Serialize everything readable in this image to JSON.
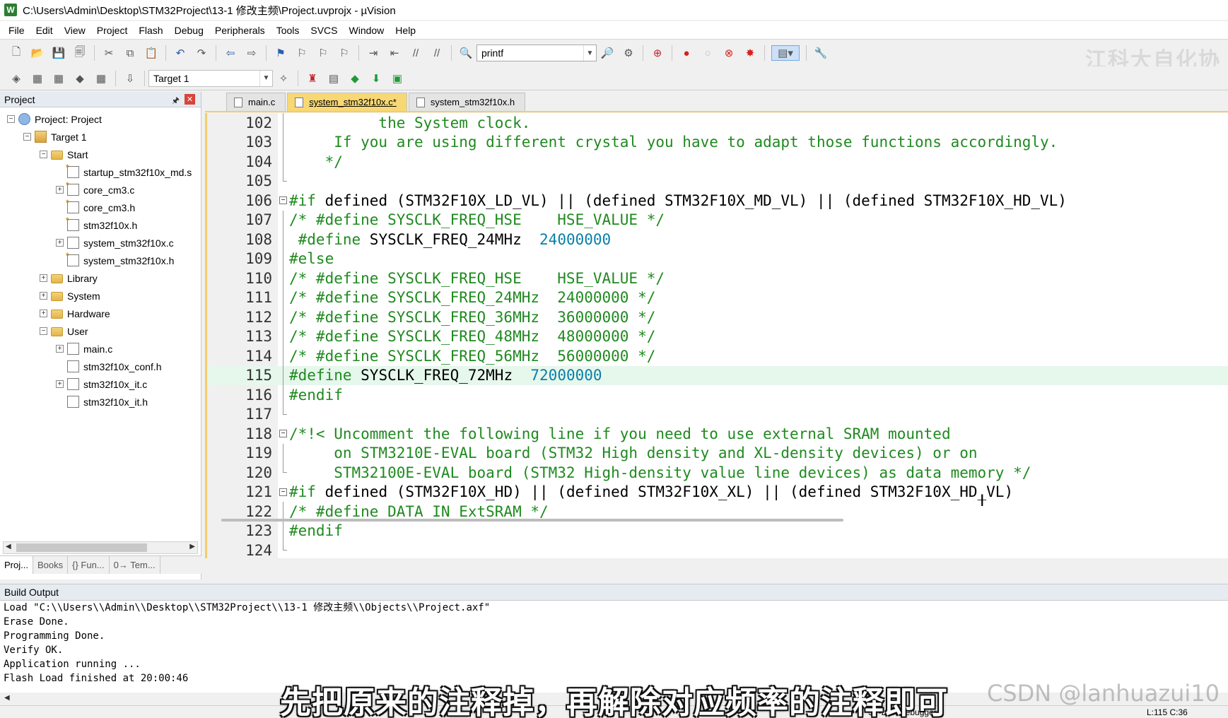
{
  "window": {
    "title": "C:\\Users\\Admin\\Desktop\\STM32Project\\13-1 修改主频\\Project.uvprojx - µVision",
    "app_icon": "W"
  },
  "menu": [
    "File",
    "Edit",
    "View",
    "Project",
    "Flash",
    "Debug",
    "Peripherals",
    "Tools",
    "SVCS",
    "Window",
    "Help"
  ],
  "toolbar1": {
    "find_value": "printf"
  },
  "toolbar2": {
    "target_value": "Target 1"
  },
  "watermark_logo": "江科大自化协",
  "project_panel": {
    "title": "Project",
    "tree": [
      {
        "label": "Project: Project",
        "expander": "−",
        "icon": "project"
      },
      {
        "label": "Target 1",
        "expander": "−",
        "icon": "target"
      },
      {
        "label": "Start",
        "expander": "−",
        "icon": "folder"
      },
      {
        "label": "startup_stm32f10x_md.s",
        "expander": "",
        "icon": "file-ast"
      },
      {
        "label": "core_cm3.c",
        "expander": "+",
        "icon": "file-ast"
      },
      {
        "label": "core_cm3.h",
        "expander": "",
        "icon": "file-ast"
      },
      {
        "label": "stm32f10x.h",
        "expander": "",
        "icon": "file-ast"
      },
      {
        "label": "system_stm32f10x.c",
        "expander": "+",
        "icon": "file"
      },
      {
        "label": "system_stm32f10x.h",
        "expander": "",
        "icon": "file-ast"
      },
      {
        "label": "Library",
        "expander": "+",
        "icon": "folder"
      },
      {
        "label": "System",
        "expander": "+",
        "icon": "folder"
      },
      {
        "label": "Hardware",
        "expander": "+",
        "icon": "folder"
      },
      {
        "label": "User",
        "expander": "−",
        "icon": "folder"
      },
      {
        "label": "main.c",
        "expander": "+",
        "icon": "file"
      },
      {
        "label": "stm32f10x_conf.h",
        "expander": "",
        "icon": "file"
      },
      {
        "label": "stm32f10x_it.c",
        "expander": "+",
        "icon": "file"
      },
      {
        "label": "stm32f10x_it.h",
        "expander": "",
        "icon": "file"
      }
    ],
    "tabs": [
      "Proj...",
      "Books",
      "{} Fun...",
      "0→ Tem..."
    ]
  },
  "editor": {
    "tabs": [
      {
        "label": "main.c",
        "active": false
      },
      {
        "label": "system_stm32f10x.c*",
        "active": true
      },
      {
        "label": "system_stm32f10x.h",
        "active": false
      }
    ],
    "lines": [
      {
        "n": "102",
        "fold": "v",
        "parts": [
          {
            "c": "cmt",
            "t": "          the System clock."
          }
        ]
      },
      {
        "n": "103",
        "fold": "v",
        "parts": [
          {
            "c": "cmt",
            "t": "     If you are using different crystal you have to adapt those functions accordingly."
          }
        ]
      },
      {
        "n": "104",
        "fold": "v",
        "parts": [
          {
            "c": "cmt",
            "t": "    */"
          }
        ]
      },
      {
        "n": "105",
        "fold": "end",
        "parts": []
      },
      {
        "n": "106",
        "fold": "box",
        "parts": [
          {
            "c": "pp",
            "t": "#if"
          },
          {
            "c": "txt",
            "t": " defined (STM32F10X_LD_VL) || (defined STM32F10X_MD_VL) || (defined STM32F10X_HD_VL)"
          }
        ]
      },
      {
        "n": "107",
        "fold": "v",
        "parts": [
          {
            "c": "cmt",
            "t": "/* #define SYSCLK_FREQ_HSE    HSE_VALUE */"
          }
        ]
      },
      {
        "n": "108",
        "fold": "v",
        "parts": [
          {
            "c": "pp",
            "t": " #define"
          },
          {
            "c": "txt",
            "t": " SYSCLK_FREQ_24MHz  "
          },
          {
            "c": "num",
            "t": "24000000"
          }
        ]
      },
      {
        "n": "109",
        "fold": "v",
        "parts": [
          {
            "c": "pp",
            "t": "#else"
          }
        ]
      },
      {
        "n": "110",
        "fold": "v",
        "parts": [
          {
            "c": "cmt",
            "t": "/* #define SYSCLK_FREQ_HSE    HSE_VALUE */"
          }
        ]
      },
      {
        "n": "111",
        "fold": "v",
        "parts": [
          {
            "c": "cmt",
            "t": "/* #define SYSCLK_FREQ_24MHz  24000000 */"
          }
        ]
      },
      {
        "n": "112",
        "fold": "v",
        "parts": [
          {
            "c": "cmt",
            "t": "/* #define SYSCLK_FREQ_36MHz  36000000 */"
          }
        ]
      },
      {
        "n": "113",
        "fold": "v",
        "parts": [
          {
            "c": "cmt",
            "t": "/* #define SYSCLK_FREQ_48MHz  48000000 */"
          }
        ]
      },
      {
        "n": "114",
        "fold": "v",
        "parts": [
          {
            "c": "cmt",
            "t": "/* #define SYSCLK_FREQ_56MHz  56000000 */"
          }
        ]
      },
      {
        "n": "115",
        "fold": "v",
        "hl": true,
        "parts": [
          {
            "c": "pp",
            "t": "#define"
          },
          {
            "c": "txt",
            "t": " SYSCLK_FREQ_72MHz  "
          },
          {
            "c": "num",
            "t": "72000000"
          }
        ]
      },
      {
        "n": "116",
        "fold": "v",
        "parts": [
          {
            "c": "pp",
            "t": "#endif"
          }
        ]
      },
      {
        "n": "117",
        "fold": "end",
        "parts": []
      },
      {
        "n": "118",
        "fold": "box",
        "parts": [
          {
            "c": "cmt",
            "t": "/*!< Uncomment the following line if you need to use external SRAM mounted"
          }
        ]
      },
      {
        "n": "119",
        "fold": "v",
        "parts": [
          {
            "c": "cmt",
            "t": "     on STM3210E-EVAL board (STM32 High density and XL-density devices) or on"
          }
        ]
      },
      {
        "n": "120",
        "fold": "end",
        "parts": [
          {
            "c": "cmt",
            "t": "     STM32100E-EVAL board (STM32 High-density value line devices) as data memory */"
          }
        ]
      },
      {
        "n": "121",
        "fold": "box",
        "parts": [
          {
            "c": "pp",
            "t": "#if"
          },
          {
            "c": "txt",
            "t": " defined (STM32F10X_HD) || (defined STM32F10X_XL) || (defined STM32F10X_HD_VL)"
          }
        ]
      },
      {
        "n": "122",
        "fold": "v",
        "parts": [
          {
            "c": "cmt",
            "t": "/* #define DATA_IN_ExtSRAM */"
          }
        ]
      },
      {
        "n": "123",
        "fold": "v",
        "parts": [
          {
            "c": "pp",
            "t": "#endif"
          }
        ]
      },
      {
        "n": "124",
        "fold": "end",
        "parts": []
      }
    ]
  },
  "build_output": {
    "title": "Build Output",
    "lines": [
      "Load \"C:\\\\Users\\\\Admin\\\\Desktop\\\\STM32Project\\\\13-1 修改主频\\\\Objects\\\\Project.axf\"",
      "Erase Done.",
      "Programming Done.",
      "Verify OK.",
      "Application running ...",
      "Flash Load finished at 20:00:46"
    ]
  },
  "status": {
    "debugger": "ST-Link Debugger",
    "position": "L:115 C:36"
  },
  "subtitle": "先把原来的注释掉，再解除对应频率的注释即可",
  "csdn_mark": "CSDN @lanhuazui10"
}
